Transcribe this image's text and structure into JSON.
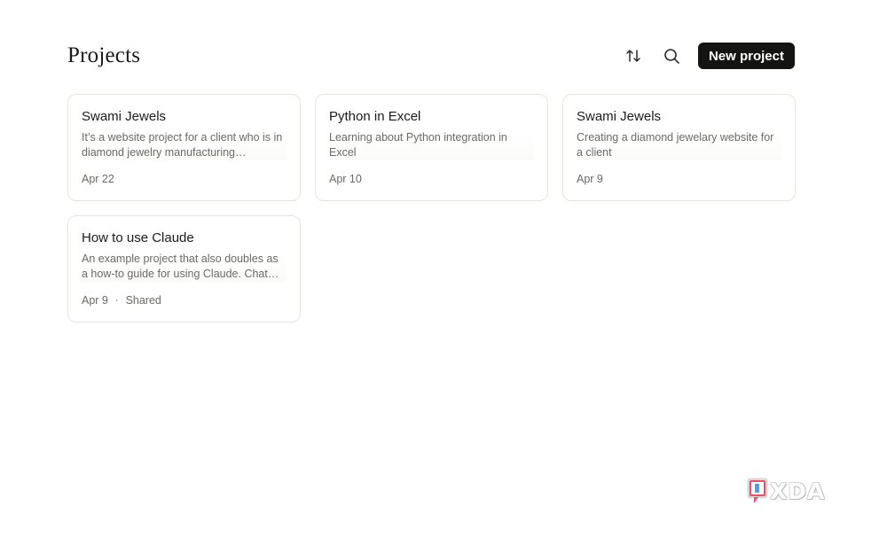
{
  "header": {
    "title": "Projects",
    "sort_icon": "sort-arrows-icon",
    "search_icon": "search-icon",
    "new_button_label": "New project"
  },
  "projects": [
    {
      "title": "Swami Jewels",
      "description": "It’s a website project for a client who is in diamond jewelry manufacturing…",
      "date": "Apr 22",
      "shared": ""
    },
    {
      "title": "Python in Excel",
      "description": "Learning about Python integration in Excel",
      "date": "Apr 10",
      "shared": ""
    },
    {
      "title": "Swami Jewels",
      "description": "Creating a diamond jewelary website for a client",
      "date": "Apr 9",
      "shared": ""
    },
    {
      "title": "How to use Claude",
      "description": "An example project that also doubles as a how-to guide for using Claude. Chat wi…",
      "date": "Apr 9",
      "separator": "·",
      "shared": "Shared"
    }
  ],
  "watermark": {
    "text": "XDA",
    "logo_icon": "xda-logo-icon",
    "colors": [
      "#e8506a",
      "#4aa3df"
    ]
  },
  "colors": {
    "background": "#ffffff",
    "primary_button": "#141413",
    "card_border": "#e6e4df",
    "muted_text": "#6b6a66"
  }
}
